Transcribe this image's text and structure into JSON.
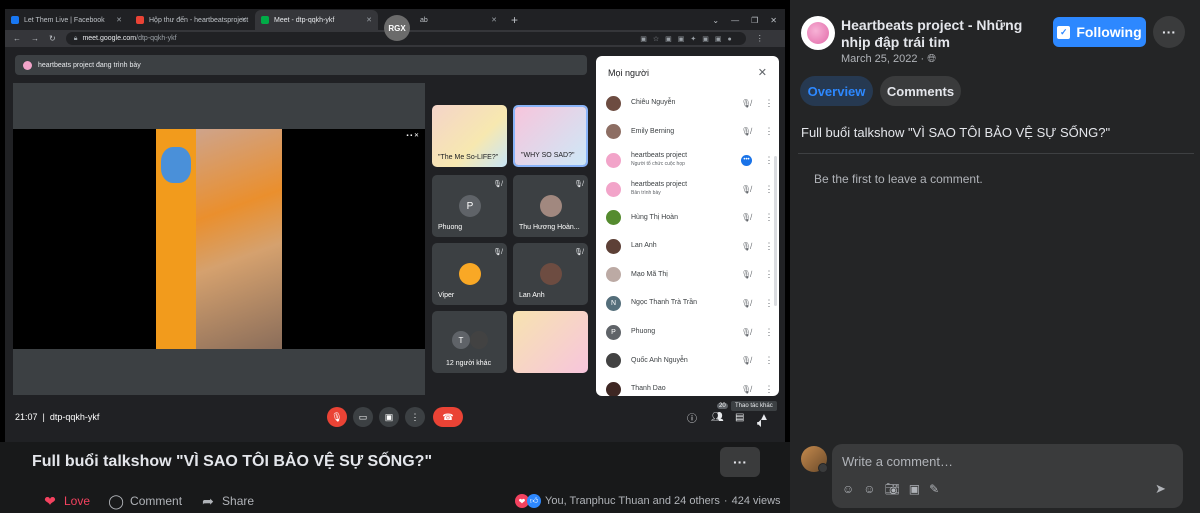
{
  "browser": {
    "tabs": [
      {
        "label": "Let Them Live | Facebook",
        "color": "#1877f2"
      },
      {
        "label": "Hộp thư đến - heartbeatsproject",
        "color": "#ea4335"
      },
      {
        "label": "Meet - dtp-qqkh-ykf",
        "color": "#00ac47"
      },
      {
        "label": "ab",
        "color": "#9aa0a6"
      }
    ],
    "rgx_label": "RGX",
    "url_domain": "meet.google.com",
    "url_path": "/dtp-qqkh-ykf"
  },
  "meet": {
    "presenting_label": "heartbeats project đang trình bày",
    "tiles": [
      {
        "name": "\"The Me So-LIFE?\"",
        "kind": "cam"
      },
      {
        "name": "\"WHY SO SAD?\"",
        "kind": "cam"
      },
      {
        "name": "Phuong",
        "initial": "P",
        "kind": "avatar"
      },
      {
        "name": "Thu Hương Hoàn...",
        "kind": "avatar"
      },
      {
        "name": "Viper",
        "kind": "avatar"
      },
      {
        "name": "Lan Anh",
        "kind": "avatar"
      },
      {
        "name": "12 người khác",
        "initial": "T",
        "kind": "avatar"
      },
      {
        "name": "",
        "kind": "cam"
      }
    ],
    "time": "21:07",
    "meeting_code": "dtp-qqkh-ykf",
    "participant_count": "20",
    "tooltip": "Thao tác khác",
    "panel": {
      "title": "Mọi người",
      "people": [
        {
          "name": "Chiêu Nguyễn",
          "sub": "",
          "color": "#6d4c41",
          "initial": ""
        },
        {
          "name": "Emily Berning",
          "sub": "",
          "color": "#8d6e63",
          "initial": ""
        },
        {
          "name": "heartbeats project",
          "sub": "Người tổ chức cuộc họp",
          "color": "#f2a4c9",
          "initial": "",
          "speaking": true
        },
        {
          "name": "heartbeats project",
          "sub": "Bản trình bày",
          "color": "#f2a4c9",
          "initial": ""
        },
        {
          "name": "Hùng Thị Hoàn",
          "sub": "",
          "color": "#558b2f",
          "initial": ""
        },
        {
          "name": "Lan Anh",
          "sub": "",
          "color": "#5d4037",
          "initial": ""
        },
        {
          "name": "Mạo Mã Thị",
          "sub": "",
          "color": "#bcaaa4",
          "initial": ""
        },
        {
          "name": "Ngọc Thanh Trà Trần",
          "sub": "",
          "color": "#546e7a",
          "initial": "N"
        },
        {
          "name": "Phuong",
          "sub": "",
          "color": "#5f6368",
          "initial": "P"
        },
        {
          "name": "Quốc Anh Nguyễn",
          "sub": "",
          "color": "#424242",
          "initial": ""
        },
        {
          "name": "Thanh Dao",
          "sub": "",
          "color": "#3e2723",
          "initial": ""
        }
      ]
    }
  },
  "post": {
    "video_title": "Full buổi talkshow \"VÌ SAO TÔI BẢO VỆ SỰ SỐNG?\"",
    "love_label": "Love",
    "comment_label": "Comment",
    "share_label": "Share",
    "reactions_text": "You, Tranphuc Thuan and 24 others",
    "views_text": "424 views"
  },
  "sidebar": {
    "page_name": "Heartbeats project - Những nhịp đập trái tim",
    "date": "March 25, 2022 ·",
    "follow_label": "Following",
    "tab_overview": "Overview",
    "tab_comments": "Comments",
    "description": "Full buổi talkshow \"VÌ SAO TÔI BẢO VỆ SỰ SỐNG?\"",
    "empty_comments": "Be the first to leave a comment.",
    "comment_placeholder": "Write a comment…"
  },
  "colors": {
    "accent": "#2d88ff",
    "love": "#f3425f",
    "meet_end": "#ea4335"
  }
}
